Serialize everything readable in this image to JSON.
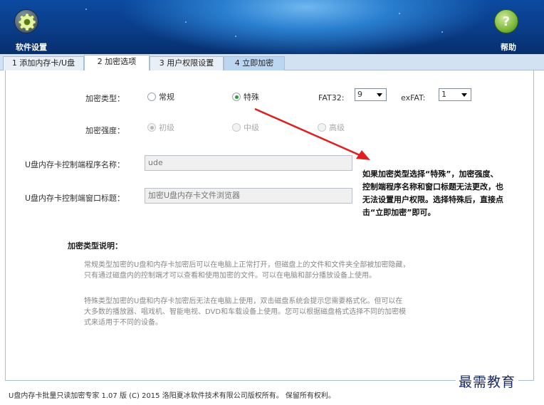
{
  "header": {
    "settings_label": "软件设置",
    "help_label": "帮助",
    "help_icon_glyph": "?"
  },
  "tabs": [
    {
      "label": "1 添加内存卡/U盘"
    },
    {
      "label": "2 加密选项"
    },
    {
      "label": "3 用户权限设置"
    },
    {
      "label": "4 立即加密"
    }
  ],
  "form": {
    "encrypt_type_label": "加密类型：",
    "type_normal": "常规",
    "type_special": "特殊",
    "fat32_label": "FAT32:",
    "fat32_value": "9",
    "exfat_label": "exFAT:",
    "exfat_value": "1",
    "strength_label": "加密强度：",
    "strength_low": "初级",
    "strength_mid": "中级",
    "strength_high": "高级",
    "program_name_label": "U盘内存卡控制端程序名称：",
    "program_name_value": "ude",
    "window_title_label": "U盘内存卡控制端窗口标题：",
    "window_title_value": "加密U盘内存卡文件浏览器"
  },
  "annotation": {
    "line1": "如果加密类型选择“特殊”，加密强度、",
    "line2": "控制端程序名称和窗口标题无法更改，也",
    "line3": "无法设置用户权限。选择特殊后，直接点",
    "line4": "击“立即加密”即可。",
    "arrow_color": "#e02020"
  },
  "description": {
    "title": "加密类型说明：",
    "p1_line1": "常规类型加密的U盘和内存卡加密后可以在电脑上正常打开，但磁盘上的文件和文件夹全部被加密隐藏，",
    "p1_line2": "只有通过磁盘内的控制端才可以查看和使用加密的文件。可以在电脑和部分播放设备上使用。",
    "p2_line1": "特殊类型加密的U盘和内存卡加密后无法在电脑上使用，双击磁盘系统会提示您需要格式化。但可以在",
    "p2_line2": "大多数的播放器、唱戏机、智能电视、DVD和车载设备上使用。您可以根据磁盘格式选择不同的加密模",
    "p2_line3": "式来适用于不同的设备。"
  },
  "footer": {
    "text": "U盘内存卡批量只读加密专家 1.07 版 (C) 2015 洛阳夏冰软件技术有限公司版权所有。 保留所有权利。"
  },
  "watermark": "最需教育"
}
